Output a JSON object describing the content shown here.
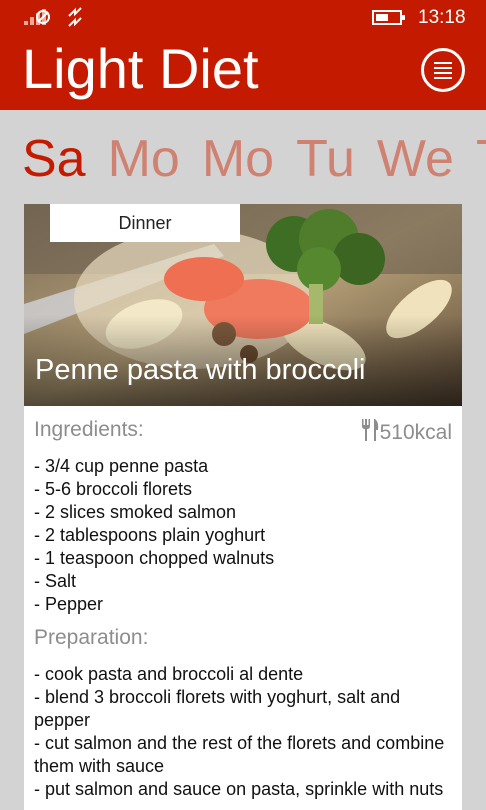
{
  "status": {
    "time": "13:18"
  },
  "app": {
    "title": "Light Diet"
  },
  "days": [
    "Sa",
    "Mo",
    "Mo",
    "Tu",
    "We",
    "T"
  ],
  "card": {
    "meal": "Dinner",
    "dish": "Penne pasta with broccoli",
    "ingredients_label": "Ingredients:",
    "kcal": "510kcal",
    "ingredients": [
      "- 3/4 cup penne pasta",
      "- 5-6 broccoli florets",
      "- 2 slices smoked salmon",
      "- 2 tablespoons plain yoghurt",
      "- 1 teaspoon chopped walnuts",
      "- Salt",
      "- Pepper"
    ],
    "preparation_label": "Preparation:",
    "preparation": [
      "- cook pasta and broccoli al dente",
      "- blend 3 broccoli florets with yoghurt, salt and pepper",
      "- cut salmon and the rest of the florets and combine them with sauce",
      "- put salmon and sauce on pasta, sprinkle with nuts"
    ]
  },
  "colors": {
    "brand": "#c41b00",
    "day_inactive": "#d08272"
  }
}
